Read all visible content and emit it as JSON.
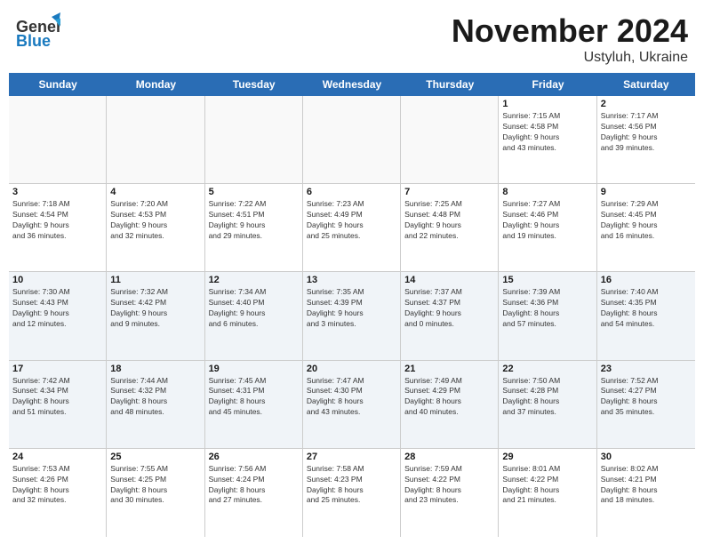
{
  "header": {
    "month_year": "November 2024",
    "location": "Ustyluh, Ukraine",
    "logo_general": "General",
    "logo_blue": "Blue"
  },
  "weekdays": [
    "Sunday",
    "Monday",
    "Tuesday",
    "Wednesday",
    "Thursday",
    "Friday",
    "Saturday"
  ],
  "weeks": [
    [
      {
        "day": "",
        "info": ""
      },
      {
        "day": "",
        "info": ""
      },
      {
        "day": "",
        "info": ""
      },
      {
        "day": "",
        "info": ""
      },
      {
        "day": "",
        "info": ""
      },
      {
        "day": "1",
        "info": "Sunrise: 7:15 AM\nSunset: 4:58 PM\nDaylight: 9 hours\nand 43 minutes."
      },
      {
        "day": "2",
        "info": "Sunrise: 7:17 AM\nSunset: 4:56 PM\nDaylight: 9 hours\nand 39 minutes."
      }
    ],
    [
      {
        "day": "3",
        "info": "Sunrise: 7:18 AM\nSunset: 4:54 PM\nDaylight: 9 hours\nand 36 minutes."
      },
      {
        "day": "4",
        "info": "Sunrise: 7:20 AM\nSunset: 4:53 PM\nDaylight: 9 hours\nand 32 minutes."
      },
      {
        "day": "5",
        "info": "Sunrise: 7:22 AM\nSunset: 4:51 PM\nDaylight: 9 hours\nand 29 minutes."
      },
      {
        "day": "6",
        "info": "Sunrise: 7:23 AM\nSunset: 4:49 PM\nDaylight: 9 hours\nand 25 minutes."
      },
      {
        "day": "7",
        "info": "Sunrise: 7:25 AM\nSunset: 4:48 PM\nDaylight: 9 hours\nand 22 minutes."
      },
      {
        "day": "8",
        "info": "Sunrise: 7:27 AM\nSunset: 4:46 PM\nDaylight: 9 hours\nand 19 minutes."
      },
      {
        "day": "9",
        "info": "Sunrise: 7:29 AM\nSunset: 4:45 PM\nDaylight: 9 hours\nand 16 minutes."
      }
    ],
    [
      {
        "day": "10",
        "info": "Sunrise: 7:30 AM\nSunset: 4:43 PM\nDaylight: 9 hours\nand 12 minutes."
      },
      {
        "day": "11",
        "info": "Sunrise: 7:32 AM\nSunset: 4:42 PM\nDaylight: 9 hours\nand 9 minutes."
      },
      {
        "day": "12",
        "info": "Sunrise: 7:34 AM\nSunset: 4:40 PM\nDaylight: 9 hours\nand 6 minutes."
      },
      {
        "day": "13",
        "info": "Sunrise: 7:35 AM\nSunset: 4:39 PM\nDaylight: 9 hours\nand 3 minutes."
      },
      {
        "day": "14",
        "info": "Sunrise: 7:37 AM\nSunset: 4:37 PM\nDaylight: 9 hours\nand 0 minutes."
      },
      {
        "day": "15",
        "info": "Sunrise: 7:39 AM\nSunset: 4:36 PM\nDaylight: 8 hours\nand 57 minutes."
      },
      {
        "day": "16",
        "info": "Sunrise: 7:40 AM\nSunset: 4:35 PM\nDaylight: 8 hours\nand 54 minutes."
      }
    ],
    [
      {
        "day": "17",
        "info": "Sunrise: 7:42 AM\nSunset: 4:34 PM\nDaylight: 8 hours\nand 51 minutes."
      },
      {
        "day": "18",
        "info": "Sunrise: 7:44 AM\nSunset: 4:32 PM\nDaylight: 8 hours\nand 48 minutes."
      },
      {
        "day": "19",
        "info": "Sunrise: 7:45 AM\nSunset: 4:31 PM\nDaylight: 8 hours\nand 45 minutes."
      },
      {
        "day": "20",
        "info": "Sunrise: 7:47 AM\nSunset: 4:30 PM\nDaylight: 8 hours\nand 43 minutes."
      },
      {
        "day": "21",
        "info": "Sunrise: 7:49 AM\nSunset: 4:29 PM\nDaylight: 8 hours\nand 40 minutes."
      },
      {
        "day": "22",
        "info": "Sunrise: 7:50 AM\nSunset: 4:28 PM\nDaylight: 8 hours\nand 37 minutes."
      },
      {
        "day": "23",
        "info": "Sunrise: 7:52 AM\nSunset: 4:27 PM\nDaylight: 8 hours\nand 35 minutes."
      }
    ],
    [
      {
        "day": "24",
        "info": "Sunrise: 7:53 AM\nSunset: 4:26 PM\nDaylight: 8 hours\nand 32 minutes."
      },
      {
        "day": "25",
        "info": "Sunrise: 7:55 AM\nSunset: 4:25 PM\nDaylight: 8 hours\nand 30 minutes."
      },
      {
        "day": "26",
        "info": "Sunrise: 7:56 AM\nSunset: 4:24 PM\nDaylight: 8 hours\nand 27 minutes."
      },
      {
        "day": "27",
        "info": "Sunrise: 7:58 AM\nSunset: 4:23 PM\nDaylight: 8 hours\nand 25 minutes."
      },
      {
        "day": "28",
        "info": "Sunrise: 7:59 AM\nSunset: 4:22 PM\nDaylight: 8 hours\nand 23 minutes."
      },
      {
        "day": "29",
        "info": "Sunrise: 8:01 AM\nSunset: 4:22 PM\nDaylight: 8 hours\nand 21 minutes."
      },
      {
        "day": "30",
        "info": "Sunrise: 8:02 AM\nSunset: 4:21 PM\nDaylight: 8 hours\nand 18 minutes."
      }
    ]
  ]
}
